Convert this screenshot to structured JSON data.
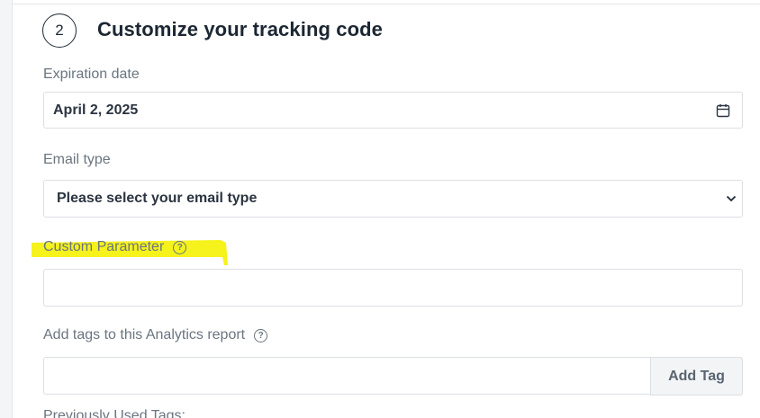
{
  "step": {
    "number": "2",
    "title": "Customize your tracking code"
  },
  "expiration": {
    "label": "Expiration date",
    "value": "April 2, 2025",
    "icon": "calendar-icon"
  },
  "email_type": {
    "label": "Email type",
    "selected": "Please select your email type",
    "icon": "chevron-down-icon"
  },
  "custom_parameter": {
    "label": "Custom Parameter",
    "value": "",
    "highlight_color": "#f5f21c",
    "help_icon": "?"
  },
  "tags": {
    "label": "Add tags to this Analytics report",
    "help_icon": "?",
    "input_value": "",
    "add_button": "Add Tag"
  },
  "previous_tags": {
    "label": "Previously Used Tags:"
  },
  "colors": {
    "text": "#1f2a37",
    "label": "#6b7580",
    "border": "#dcdfe3",
    "highlight": "#f5f21c"
  }
}
